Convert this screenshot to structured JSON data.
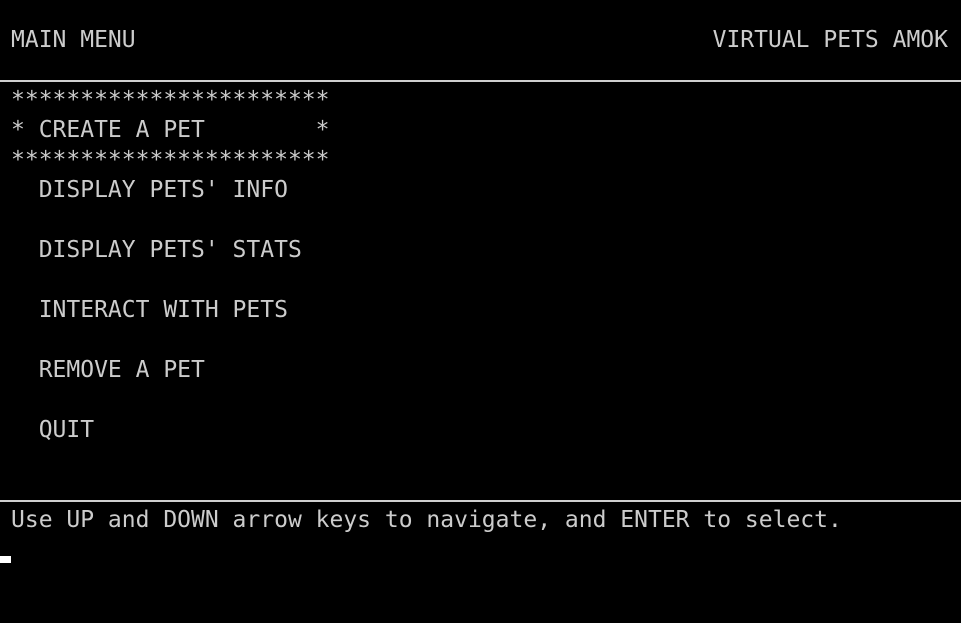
{
  "header": {
    "title": "MAIN MENU",
    "app_name": "VIRTUAL PETS AMOK"
  },
  "menu": {
    "border_top": "***********************",
    "border_bottom": "***********************",
    "items": [
      {
        "text": "* CREATE A PET        *",
        "selected": true
      },
      {
        "text": "  DISPLAY PETS' INFO",
        "selected": false
      },
      {
        "text": "  DISPLAY PETS' STATS",
        "selected": false
      },
      {
        "text": "  INTERACT WITH PETS",
        "selected": false
      },
      {
        "text": "  REMOVE A PET",
        "selected": false
      },
      {
        "text": "  QUIT",
        "selected": false
      }
    ]
  },
  "footer": {
    "instructions": "Use UP and DOWN arrow keys to navigate, and ENTER to select."
  },
  "colors": {
    "background": "#000000",
    "text": "#cccccc",
    "rule": "#cfcfcf",
    "cursor": "#ffffff"
  }
}
